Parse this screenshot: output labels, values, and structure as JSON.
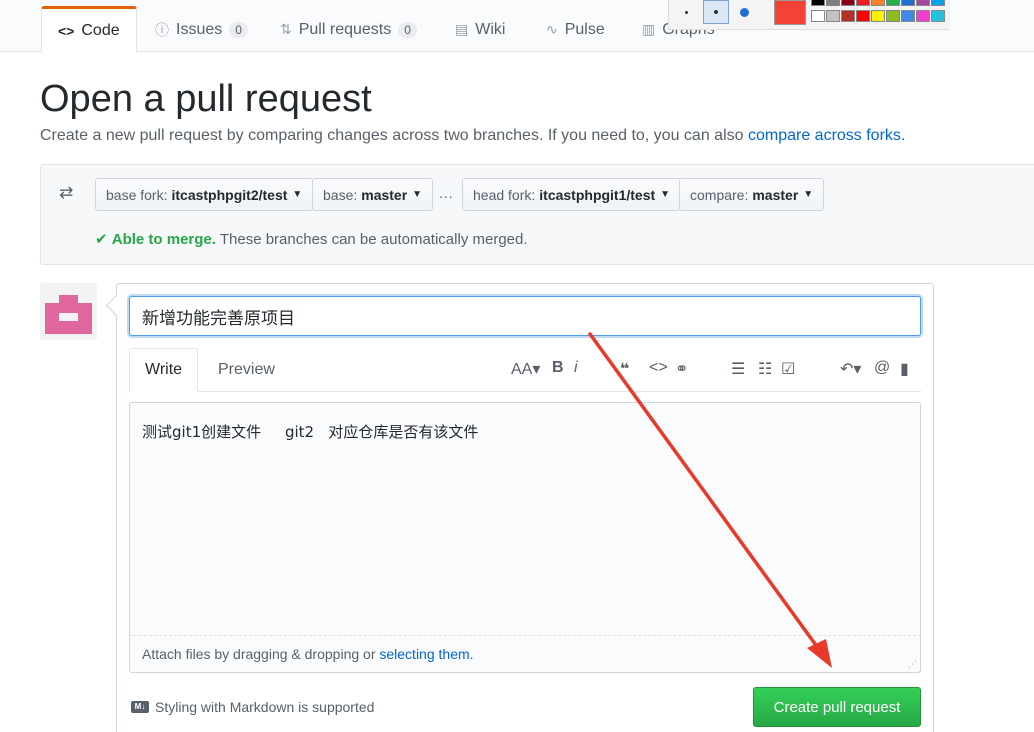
{
  "nav": {
    "tabs": [
      {
        "icon": "<>",
        "label": "Code"
      },
      {
        "icon": "ⓘ",
        "label": "Issues",
        "count": "0"
      },
      {
        "icon": "⇅",
        "label": "Pull requests",
        "count": "0"
      },
      {
        "icon": "▤",
        "label": "Wiki"
      },
      {
        "icon": "∿",
        "label": "Pulse"
      },
      {
        "icon": "▥",
        "label": "Graphs"
      }
    ]
  },
  "paint_toolbar": {
    "current_color": "#f44336",
    "palette": [
      "#000000",
      "#7f7f7f",
      "#880015",
      "#ed1c24",
      "#ff7f27",
      "#22b14c",
      "#1e6fd0",
      "#a349a4",
      "#00a2e8",
      "#ffffff",
      "#c3c3c3",
      "#b5322a",
      "#ff0000",
      "#fff200",
      "#8fbc1f",
      "#3f88e8",
      "#ee3fcf",
      "#22c3d8"
    ]
  },
  "page": {
    "title": "Open a pull request",
    "subtitle": "Create a new pull request by comparing changes across two branches. If you need to, you can also ",
    "subtitle_link": "compare across forks."
  },
  "range": {
    "base_fork_label": "base fork:",
    "base_fork_value": "itcastphpgit2/test",
    "base_label": "base:",
    "base_value": "master",
    "dots": "...",
    "head_fork_label": "head fork:",
    "head_fork_value": "itcastphpgit1/test",
    "compare_label": "compare:",
    "compare_value": "master",
    "merge_ok": "Able to merge.",
    "merge_text": "These branches can be automatically merged."
  },
  "form": {
    "title_value": "新增功能完善原项目",
    "tab_write": "Write",
    "tab_preview": "Preview",
    "body_value": "测试git1创建文件     git2   对应仓库是否有该文件",
    "attach_text": "Attach files by dragging & dropping or ",
    "attach_link": "selecting them.",
    "markdown_note": "Styling with Markdown is supported",
    "submit_label": "Create pull request"
  },
  "colors": {
    "accent_blue": "#0366d6",
    "success_green": "#28a745",
    "annotation_arrow": "#e8392a"
  }
}
